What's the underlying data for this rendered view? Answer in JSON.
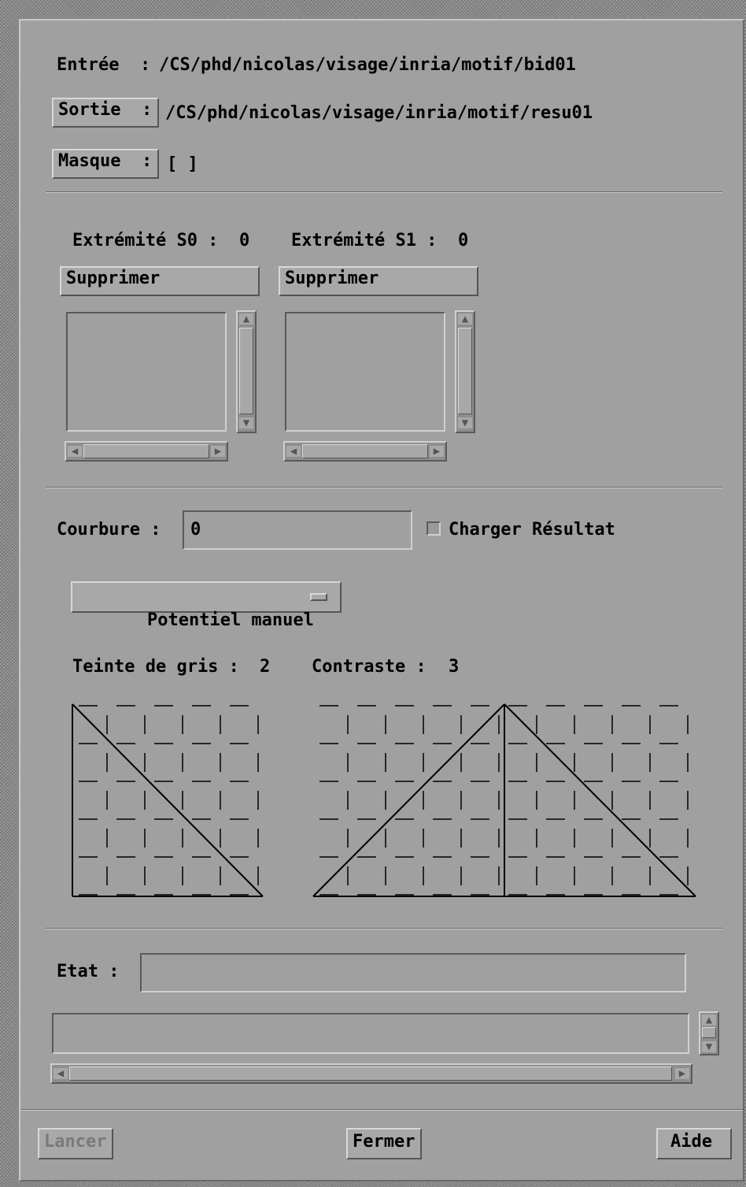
{
  "io": {
    "entree_label": "Entrée  :",
    "entree_path": "/CS/phd/nicolas/visage/inria/motif/bid01",
    "sortie_button": "Sortie  :",
    "sortie_path": "/CS/phd/nicolas/visage/inria/motif/resu01",
    "masque_button": "Masque  :",
    "masque_value": "[ ]"
  },
  "extremites": {
    "s0_label": "Extrémité S0 :",
    "s0_value": "0",
    "s1_label": "Extrémité S1 :",
    "s1_value": "0",
    "supprimer_s0": "Supprimer",
    "supprimer_s1": "Supprimer"
  },
  "courbure": {
    "label": "Courbure :",
    "value": "0",
    "charger_resultat": "Charger Résultat",
    "charger_checked": false
  },
  "potentiel": {
    "selected": "Potentiel manuel"
  },
  "gris": {
    "teinte_label": "Teinte de gris :",
    "teinte_value": "2",
    "contraste_label": "Contraste :",
    "contraste_value": "3"
  },
  "etat": {
    "label": "Etat :",
    "value": ""
  },
  "footer": {
    "lancer": "Lancer",
    "fermer": "Fermer",
    "aide": "Aide"
  }
}
